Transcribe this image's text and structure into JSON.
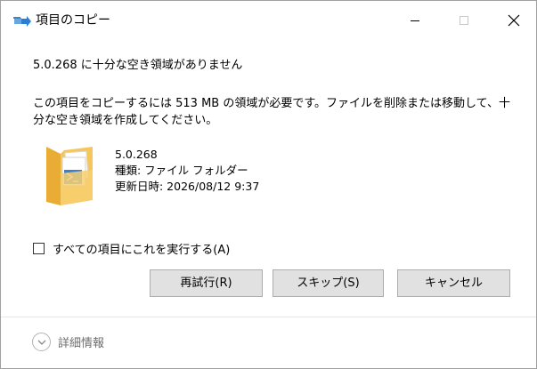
{
  "window": {
    "title": "項目のコピー",
    "icon": "copy-arrow-icon"
  },
  "titlebar_buttons": {
    "minimize": "minimize-icon",
    "maximize": "maximize-icon",
    "close": "close-icon"
  },
  "dialog": {
    "headline": "5.0.268 に十分な空き領域がありません",
    "message": "この項目をコピーするには 513 MB の領域が必要です。ファイルを削除または移動して、十分な空き領域を作成してください。"
  },
  "file": {
    "icon": "folder-icon",
    "name": "5.0.268",
    "type_line": "種類: ファイル フォルダー",
    "modified_line": "更新日時: 2026/08/12 9:37"
  },
  "apply_all": {
    "label": "すべての項目にこれを実行する(A)",
    "checked": false
  },
  "buttons": {
    "retry": "再試行(R)",
    "skip": "スキップ(S)",
    "cancel": "キャンセル"
  },
  "footer": {
    "details_label": "詳細情報",
    "details_icon": "chevron-down-icon"
  },
  "colors": {
    "button_face": "#e1e1e1",
    "button_border": "#adadad",
    "folder_yellow": "#f5c65a",
    "title_arrow_blue": "#2a7fd4"
  }
}
